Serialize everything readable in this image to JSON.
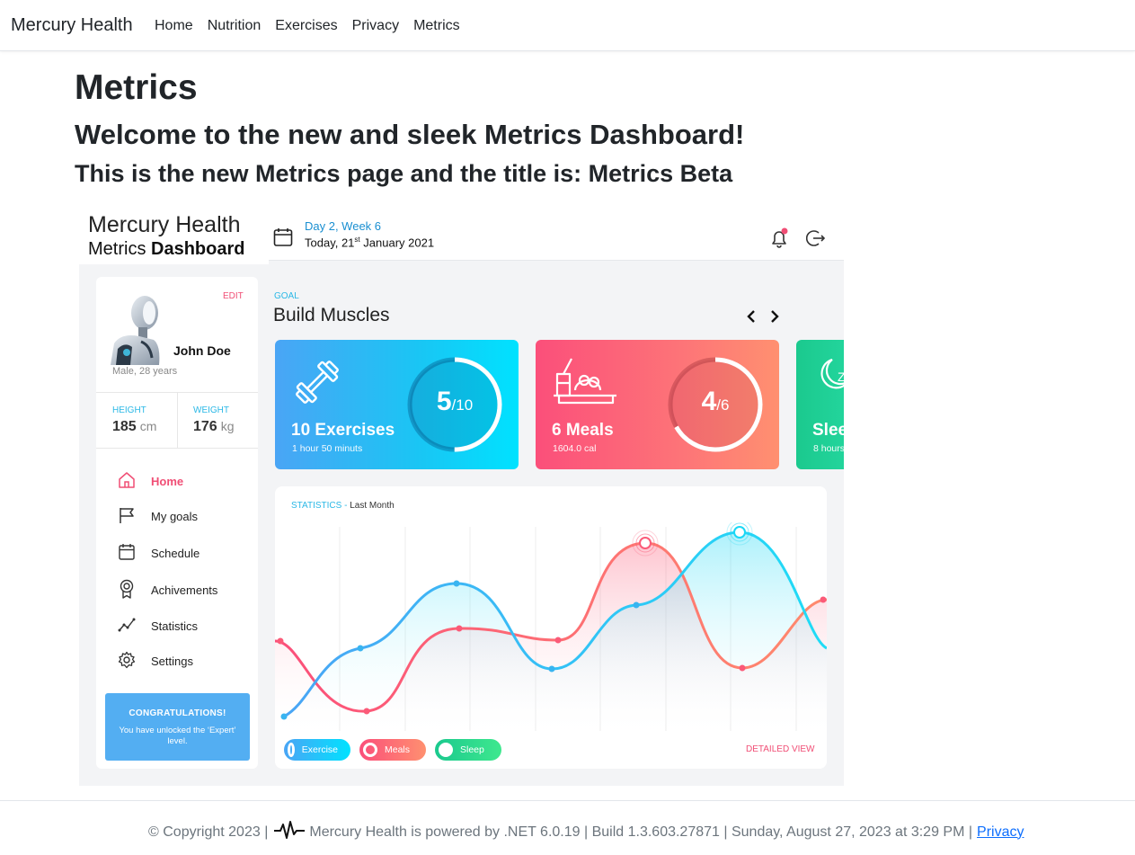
{
  "navbar": {
    "brand": "Mercury Health",
    "links": [
      "Home",
      "Nutrition",
      "Exercises",
      "Privacy",
      "Metrics"
    ]
  },
  "page": {
    "title": "Metrics",
    "welcome": "Welcome to the new and sleek Metrics Dashboard!",
    "subtitle": "This is the new Metrics page and the title is: Metrics Beta"
  },
  "dashboard": {
    "logo_line1": "Mercury Health",
    "logo_line2_plain": "Metrics ",
    "logo_line2_bold": "Dashboard",
    "day_week": "Day 2, Week 6",
    "today_prefix": "Today, 21",
    "today_sup": "st",
    "today_suffix": " January 2021",
    "profile": {
      "edit": "EDIT",
      "name": "John Doe",
      "meta": "Male, 28 years",
      "height_label": "HEIGHT",
      "height_value": "185",
      "height_unit": "cm",
      "weight_label": "WEIGHT",
      "weight_value": "176",
      "weight_unit": "kg"
    },
    "menu": [
      {
        "label": "Home",
        "icon": "home-icon",
        "active": true
      },
      {
        "label": "My goals",
        "icon": "flag-icon",
        "active": false
      },
      {
        "label": "Schedule",
        "icon": "calendar-icon",
        "active": false
      },
      {
        "label": "Achivements",
        "icon": "medal-icon",
        "active": false
      },
      {
        "label": "Statistics",
        "icon": "trend-icon",
        "active": false
      },
      {
        "label": "Settings",
        "icon": "gear-icon",
        "active": false
      }
    ],
    "congrats": {
      "title": "CONGRATULATIONS!",
      "body": "You have unlocked the ‘Expert’ level."
    },
    "goal": {
      "label": "GOAL",
      "title": "Build Muscles"
    },
    "cards": [
      {
        "title": "10 Exercises",
        "sub": "1 hour 50 minuts",
        "ring_value": "5",
        "ring_total": "/10",
        "progress": 0.5,
        "icon": "dumbbell-icon"
      },
      {
        "title": "6 Meals",
        "sub": "1604.0 cal",
        "ring_value": "4",
        "ring_total": "/6",
        "progress": 0.6667,
        "icon": "meal-icon"
      },
      {
        "title": "Slee",
        "sub": "8 hours",
        "icon": "moon-icon"
      }
    ],
    "stats": {
      "label": "STATISTICS",
      "period": "Last Month",
      "detailed": "DETAILED VIEW",
      "legend": [
        "Exercise",
        "Meals",
        "Sleep"
      ]
    },
    "colors": {
      "accent_pink": "#f04e75",
      "accent_blue": "#2bb8e6",
      "exercise": "#29c6f6",
      "meals": "#fb5a78",
      "sleep": "#1bc98e"
    }
  },
  "footer": {
    "copyright": "© Copyright 2023 |",
    "powered": "Mercury Health is powered by .NET 6.0.19 | Build 1.3.603.27871 | Sunday, August 27, 2023 at 3:29 PM |",
    "privacy": "Privacy"
  }
}
